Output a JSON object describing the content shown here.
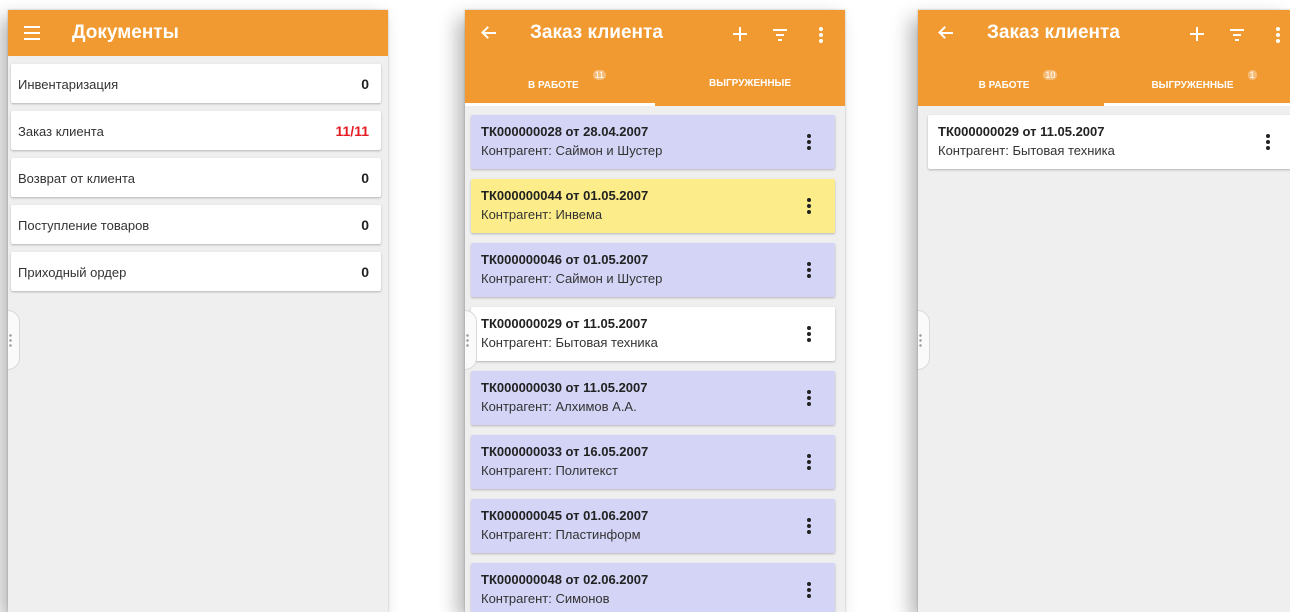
{
  "screen1": {
    "title": "Документы",
    "rows": [
      {
        "name": "Инвентаризация",
        "count": "0"
      },
      {
        "name": "Заказ клиента",
        "count": "11/11"
      },
      {
        "name": "Возврат от клиента",
        "count": "0"
      },
      {
        "name": "Поступление товаров",
        "count": "0"
      },
      {
        "name": "Приходный ордер",
        "count": "0"
      }
    ]
  },
  "screen2": {
    "title": "Заказ клиента",
    "tabs": [
      {
        "label": "В РАБОТЕ",
        "badge": "11"
      },
      {
        "label": "ВЫГРУЖЕННЫЕ",
        "badge": ""
      }
    ],
    "orders": [
      {
        "doc": "ТК000000028 от 28.04.2007",
        "partner": "Контрагент: Саймон и Шустер"
      },
      {
        "doc": "ТК000000044 от 01.05.2007",
        "partner": "Контрагент: Инвема"
      },
      {
        "doc": "ТК000000046 от 01.05.2007",
        "partner": "Контрагент: Саймон и Шустер"
      },
      {
        "doc": "ТК000000029 от 11.05.2007",
        "partner": "Контрагент: Бытовая техника"
      },
      {
        "doc": "ТК000000030 от 11.05.2007",
        "partner": "Контрагент: Алхимов А.А."
      },
      {
        "doc": "ТК000000033 от 16.05.2007",
        "partner": "Контрагент: Политекст"
      },
      {
        "doc": "ТК000000045 от 01.06.2007",
        "partner": "Контрагент: Пластинформ"
      },
      {
        "doc": "ТК000000048 от 02.06.2007",
        "partner": "Контрагент: Симонов"
      }
    ]
  },
  "screen3": {
    "title": "Заказ клиента",
    "tabs": [
      {
        "label": "В РАБОТЕ",
        "badge": "10"
      },
      {
        "label": "ВЫГРУЖЕННЫЕ",
        "badge": "1"
      }
    ],
    "orders": [
      {
        "doc": "ТК000000029 от 11.05.2007",
        "partner": "Контрагент: Бытовая техника"
      }
    ]
  },
  "colors": {
    "accent": "#f29a32",
    "row_purple": "#d3d4f6",
    "row_yellow": "#fded8a",
    "count_highlight": "#e51c23"
  },
  "icons": [
    "menu-icon",
    "back-arrow-icon",
    "add-icon",
    "filter-icon",
    "more-vert-icon"
  ]
}
